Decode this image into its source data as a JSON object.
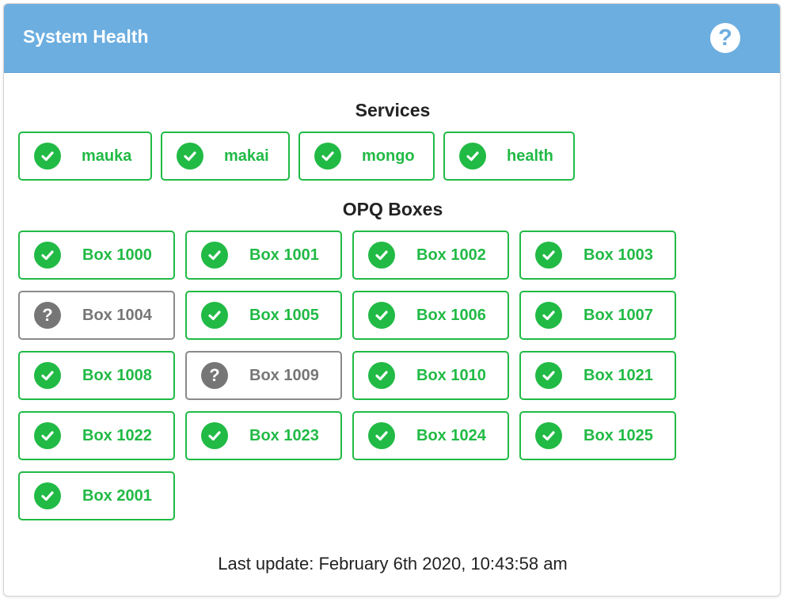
{
  "header": {
    "title": "System Health",
    "help_icon": "question-circle-icon"
  },
  "colors": {
    "header_bg": "#6caee0",
    "ok": "#21ba45",
    "unknown": "#767676"
  },
  "services": {
    "title": "Services",
    "items": [
      {
        "label": "mauka",
        "status": "ok"
      },
      {
        "label": "makai",
        "status": "ok"
      },
      {
        "label": "mongo",
        "status": "ok"
      },
      {
        "label": "health",
        "status": "ok"
      }
    ]
  },
  "boxes": {
    "title": "OPQ Boxes",
    "items": [
      {
        "label": "Box 1000",
        "status": "ok"
      },
      {
        "label": "Box 1001",
        "status": "ok"
      },
      {
        "label": "Box 1002",
        "status": "ok"
      },
      {
        "label": "Box 1003",
        "status": "ok"
      },
      {
        "label": "Box 1004",
        "status": "unknown"
      },
      {
        "label": "Box 1005",
        "status": "ok"
      },
      {
        "label": "Box 1006",
        "status": "ok"
      },
      {
        "label": "Box 1007",
        "status": "ok"
      },
      {
        "label": "Box 1008",
        "status": "ok"
      },
      {
        "label": "Box 1009",
        "status": "unknown"
      },
      {
        "label": "Box 1010",
        "status": "ok"
      },
      {
        "label": "Box 1021",
        "status": "ok"
      },
      {
        "label": "Box 1022",
        "status": "ok"
      },
      {
        "label": "Box 1023",
        "status": "ok"
      },
      {
        "label": "Box 1024",
        "status": "ok"
      },
      {
        "label": "Box 1025",
        "status": "ok"
      },
      {
        "label": "Box 2001",
        "status": "ok"
      }
    ]
  },
  "footer": {
    "last_update": "Last update: February 6th 2020, 10:43:58 am"
  }
}
